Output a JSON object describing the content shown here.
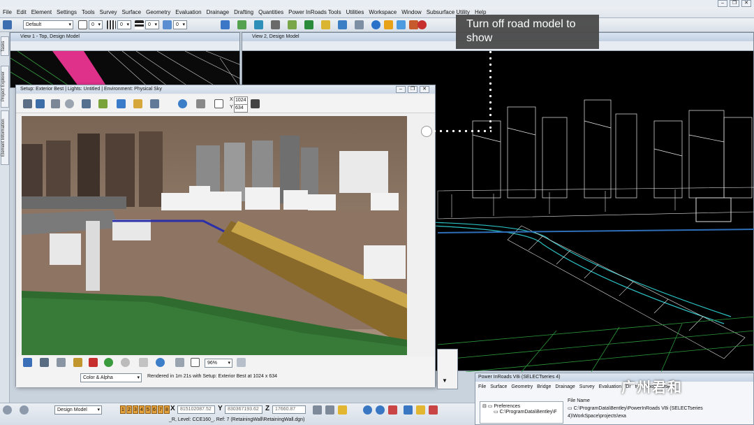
{
  "menu": [
    "File",
    "Edit",
    "Element",
    "Settings",
    "Tools",
    "Survey",
    "Surface",
    "Geometry",
    "Evaluation",
    "Drainage",
    "Drafting",
    "Quantities",
    "Power InRoads Tools",
    "Utilities",
    "Workspace",
    "Window",
    "Subsurface Utility",
    "Help"
  ],
  "toolbar": {
    "level_combo": "Default",
    "weight_value_1": "0",
    "weight_value_2": "0",
    "weight_value_3": "0",
    "weight_value_4": "0"
  },
  "side_tabs": [
    "Tasks",
    "Project Explorer",
    "Element Information"
  ],
  "view1": {
    "title": "View 1 - Top, Design Model"
  },
  "view2": {
    "title": "View 2, Design Model"
  },
  "render": {
    "title": "Setup: Exterior Best | Lights: Untitled | Environment: Physical Sky",
    "x_label": "X",
    "x_value": "1024",
    "y_label": "Y",
    "y_value": "634",
    "zoom": "96%",
    "mode": "Color & Alpha",
    "status": "Rendered in 1m 21s with Setup: Exterior Best at 1024 x 634"
  },
  "callout": {
    "text": "Turn off road model to show"
  },
  "pir": {
    "title": "Power InRoads V8i (SELECTseries 4)",
    "menu": [
      "File",
      "Surface",
      "Geometry",
      "Bridge",
      "Drainage",
      "Survey",
      "Evaluation",
      "Dr",
      "tes",
      "Tools",
      "Use"
    ],
    "tree_root": "Preferences",
    "tree_child": "C:\\ProgramData\\Bentley\\F",
    "file_name_label": "File Name",
    "file_path": "C:\\ProgramData\\Bentley\\PowerInRoads V8i (SELECTseries 4)\\WorkSpace\\projects\\exa"
  },
  "status": {
    "model_combo": "Design Model",
    "view_buttons": [
      "1",
      "2",
      "3",
      "4",
      "5",
      "6",
      "7",
      "8"
    ],
    "x_label": "X",
    "x_value": "815102087.52",
    "y_label": "Y",
    "y_value": "830367193.62",
    "z_label": "Z",
    "z_value": "17660.87",
    "bottom_line": "_R, Level: CCE160_, Ref: 7 (RetainingWall\\RetainingWall.dgn)"
  },
  "watermark": "广州君和",
  "colors": {
    "accent": "#2f6fba",
    "callout_bg": "#4a4a4a",
    "viewport_bg": "#000000"
  }
}
